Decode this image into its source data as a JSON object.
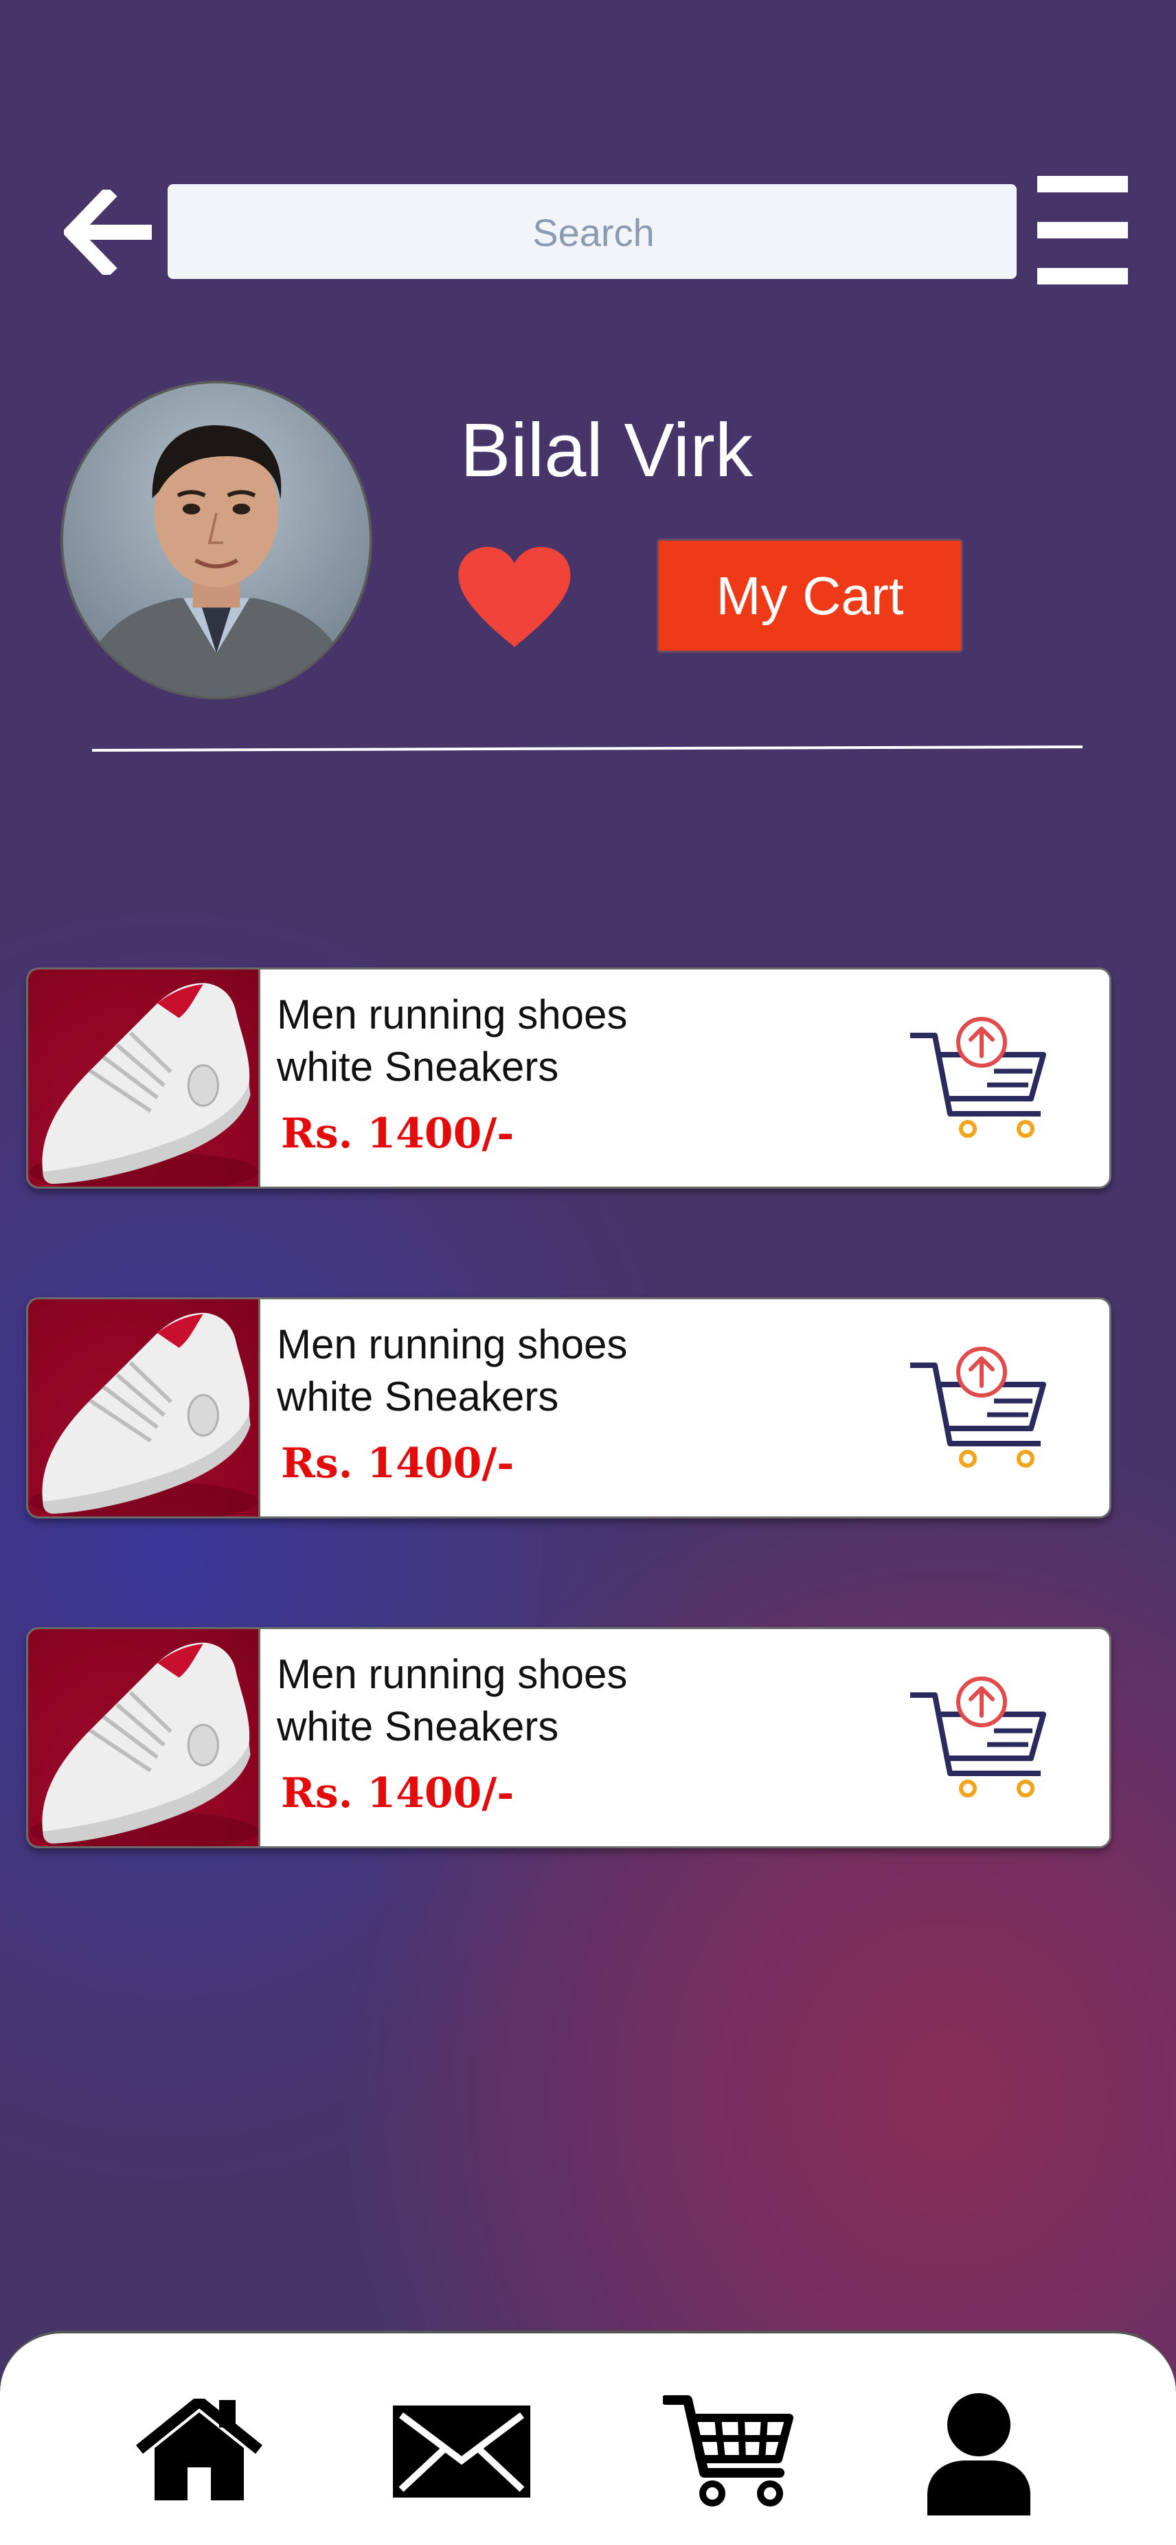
{
  "search": {
    "placeholder": "Search"
  },
  "profile": {
    "name": "Bilal Virk",
    "cart_button_label": "My Cart"
  },
  "colors": {
    "accent": "#ee3a17",
    "price": "#e30b0b",
    "heart": "#f0443a",
    "cart_icon_navy": "#2b2a5e",
    "cart_icon_orange": "#f2a41c"
  },
  "icons": {
    "back": "arrow-left-icon",
    "menu": "hamburger-menu-icon",
    "favorite": "heart-icon",
    "add_to_cart": "cart-upload-icon",
    "nav": [
      "home-icon",
      "mail-icon",
      "shopping-cart-icon",
      "user-icon"
    ]
  },
  "products": [
    {
      "title_line1": "Men running shoes",
      "title_line2": "white Sneakers",
      "price": "Rs. 1400/-"
    },
    {
      "title_line1": "Men running shoes",
      "title_line2": "white Sneakers",
      "price": "Rs. 1400/-"
    },
    {
      "title_line1": "Men running shoes",
      "title_line2": "white Sneakers",
      "price": "Rs. 1400/-"
    }
  ]
}
